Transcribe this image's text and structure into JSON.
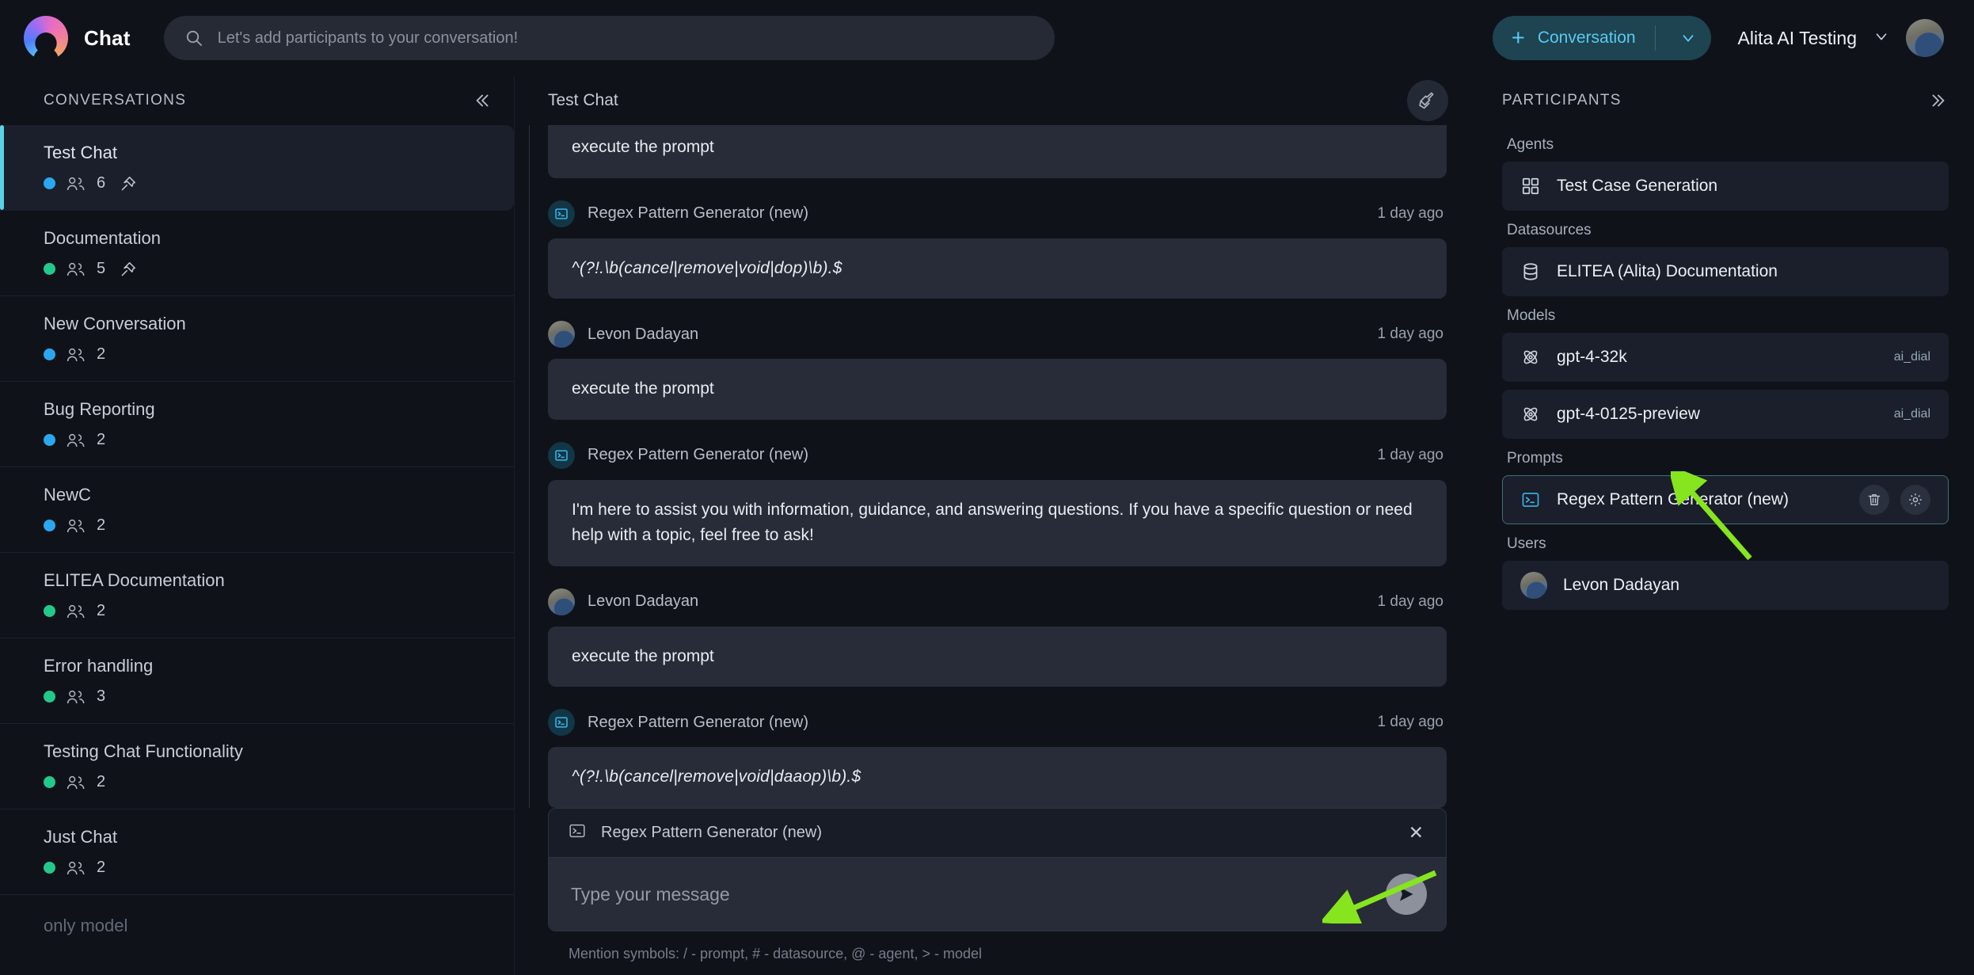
{
  "topbar": {
    "brand_title": "Chat",
    "logo_icon": "alita-logo-icon",
    "search_placeholder": "Let's add participants to your conversation!",
    "search_value": "",
    "search_icon": "search-icon",
    "new_conversation_label": "Conversation",
    "new_conversation_plus": "+",
    "account_name": "Alita AI Testing",
    "account_caret_icon": "chevron-down-icon",
    "avatar_icon": "user-avatar"
  },
  "sidebar": {
    "title": "CONVERSATIONS",
    "collapse_icon": "chevron-double-left-icon",
    "status_colors": {
      "blue": "#2aa8ef",
      "green": "#23c98c"
    },
    "conversations": [
      {
        "name": "Test Chat",
        "status": "blue",
        "count": "6",
        "pinned": true,
        "active": true
      },
      {
        "name": "Documentation",
        "status": "green",
        "count": "5",
        "pinned": true,
        "active": false
      },
      {
        "name": "New Conversation",
        "status": "blue",
        "count": "2",
        "pinned": false,
        "active": false
      },
      {
        "name": "Bug Reporting",
        "status": "blue",
        "count": "2",
        "pinned": false,
        "active": false
      },
      {
        "name": "NewC",
        "status": "blue",
        "count": "2",
        "pinned": false,
        "active": false
      },
      {
        "name": "ELITEA Documentation",
        "status": "green",
        "count": "2",
        "pinned": false,
        "active": false
      },
      {
        "name": "Error handling",
        "status": "green",
        "count": "3",
        "pinned": false,
        "active": false
      },
      {
        "name": "Testing Chat Functionality",
        "status": "green",
        "count": "2",
        "pinned": false,
        "active": false
      },
      {
        "name": "Just Chat",
        "status": "green",
        "count": "2",
        "pinned": false,
        "active": false
      }
    ],
    "last_partial": "only model"
  },
  "chat": {
    "title": "Test Chat",
    "clean_icon": "broom-icon",
    "messages": [
      {
        "kind": "continuation",
        "text": "execute the prompt"
      },
      {
        "kind": "assistant",
        "author": "Regex Pattern Generator (new)",
        "avatar_icon": "terminal-prompt-icon",
        "time": "1 day ago",
        "text": "^(?!.\\b(cancel|remove|void|dop)\\b).$",
        "code": true
      },
      {
        "kind": "user",
        "author": "Levon Dadayan",
        "avatar_icon": "user-avatar",
        "time": "1 day ago",
        "text": "execute the prompt",
        "code": false
      },
      {
        "kind": "assistant",
        "author": "Regex Pattern Generator (new)",
        "avatar_icon": "terminal-prompt-icon",
        "time": "1 day ago",
        "text": "I'm here to assist you with information, guidance, and answering questions. If you have a specific question or need help with a topic, feel free to ask!",
        "code": false
      },
      {
        "kind": "user",
        "author": "Levon Dadayan",
        "avatar_icon": "user-avatar",
        "time": "1 day ago",
        "text": "execute the prompt",
        "code": false
      },
      {
        "kind": "assistant",
        "author": "Regex Pattern Generator (new)",
        "avatar_icon": "terminal-prompt-icon",
        "time": "1 day ago",
        "text": "^(?!.\\b(cancel|remove|void|daaop)\\b).$",
        "code": true
      }
    ],
    "composer": {
      "chip_label": "Regex Pattern Generator (new)",
      "chip_icon": "terminal-prompt-icon",
      "chip_close_icon": "close-icon",
      "input_placeholder": "Type your message",
      "input_value": "",
      "send_icon": "send-icon",
      "hint": "Mention symbols: / - prompt, # - datasource, @ - agent, > - model"
    }
  },
  "participants": {
    "title": "PARTICIPANTS",
    "collapse_icon": "chevron-double-right-icon",
    "groups": [
      {
        "label": "Agents",
        "items": [
          {
            "name": "Test Case Generation",
            "icon": "grid-agent-icon",
            "sub": "",
            "selected": false,
            "actions": false
          }
        ]
      },
      {
        "label": "Datasources",
        "items": [
          {
            "name": "ELITEA (Alita) Documentation",
            "icon": "database-icon",
            "sub": "",
            "selected": false,
            "actions": false
          }
        ]
      },
      {
        "label": "Models",
        "items": [
          {
            "name": "gpt-4-32k",
            "icon": "model-atom-icon",
            "sub": "ai_dial",
            "selected": false,
            "actions": false
          },
          {
            "name": "gpt-4-0125-preview",
            "icon": "model-atom-icon",
            "sub": "ai_dial",
            "selected": false,
            "actions": false
          }
        ]
      },
      {
        "label": "Prompts",
        "items": [
          {
            "name": "Regex Pattern Generator (new)",
            "icon": "terminal-prompt-icon",
            "sub": "",
            "selected": true,
            "actions": true
          }
        ]
      },
      {
        "label": "Users",
        "items": [
          {
            "name": "Levon Dadayan",
            "icon": "user-avatar",
            "sub": "",
            "selected": false,
            "actions": false
          }
        ]
      }
    ],
    "action_icons": {
      "delete": "trash-icon",
      "settings": "gear-icon"
    }
  },
  "annotations": {
    "arrow_color": "#86e51e",
    "arrows": [
      {
        "name": "arrow-to-prompt-chip"
      },
      {
        "name": "arrow-to-prompt-participant"
      }
    ]
  }
}
